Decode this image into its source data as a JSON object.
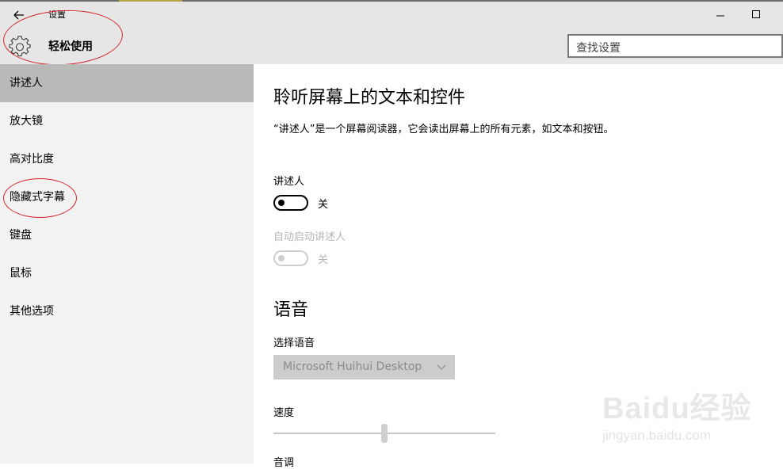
{
  "window": {
    "title": "设置",
    "back_icon": "back-arrow-icon",
    "minimize_icon": "minimize-icon",
    "maximize_icon": "maximize-icon"
  },
  "header": {
    "category_icon": "gear-icon",
    "category_title": "轻松使用",
    "search_placeholder": "查找设置"
  },
  "sidebar": {
    "items": [
      {
        "label": "讲述人",
        "selected": true
      },
      {
        "label": "放大镜"
      },
      {
        "label": "高对比度"
      },
      {
        "label": "隐藏式字幕"
      },
      {
        "label": "键盘"
      },
      {
        "label": "鼠标"
      },
      {
        "label": "其他选项"
      }
    ]
  },
  "main": {
    "heading": "聆听屏幕上的文本和控件",
    "description": "“讲述人”是一个屏幕阅读器，它会读出屏幕上的所有元素，如文本和按钮。",
    "narrator": {
      "label": "讲述人",
      "state": "关"
    },
    "auto_start": {
      "label": "自动启动讲述人",
      "state": "关"
    },
    "voice_heading": "语音",
    "voice_select_label": "选择语音",
    "voice_selected": "Microsoft Huihui Desktop",
    "speed_label": "速度",
    "speed_level_percent": 50,
    "pitch_label": "音调"
  },
  "watermark": {
    "brand": "Baidu经验",
    "url": "jingyan.baidu.com"
  },
  "colors": {
    "header_bg": "#e6e6e6",
    "sidebar_bg": "#f2f2f2",
    "selected_item_bg": "#b8bab7",
    "annotation_red": "#d4252a"
  }
}
